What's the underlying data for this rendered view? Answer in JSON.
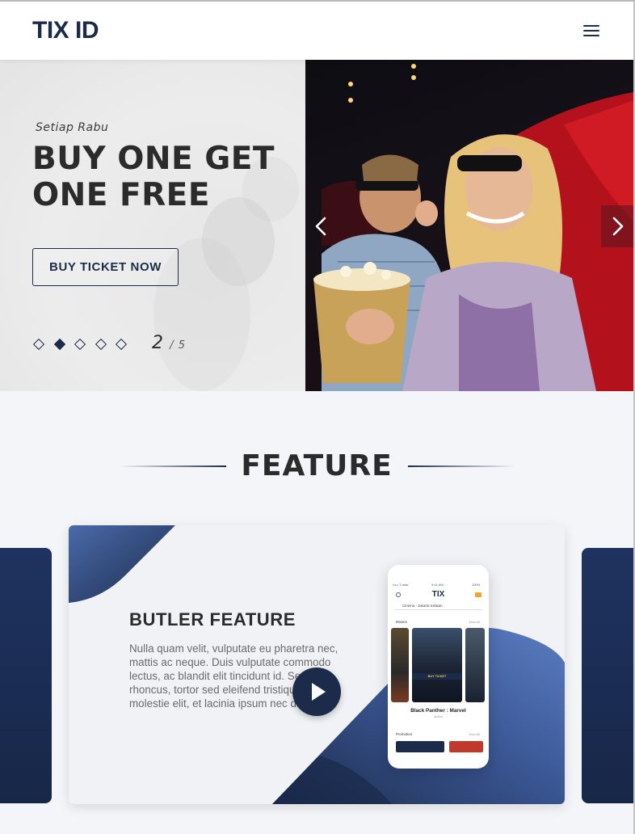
{
  "header": {
    "logo": "TIX ID",
    "menu_icon": "hamburger-menu-icon"
  },
  "hero": {
    "subtitle": "Setiap Rabu",
    "headline": "BUY ONE GET ONE FREE",
    "cta_label": "BUY TICKET NOW",
    "slide_current": "2",
    "slide_separator": "/",
    "slide_total": "5",
    "dots": [
      {
        "active": false
      },
      {
        "active": true
      },
      {
        "active": false
      },
      {
        "active": false
      },
      {
        "active": false
      }
    ],
    "prev_icon": "chevron-left-icon",
    "next_icon": "chevron-right-icon"
  },
  "feature": {
    "heading": "FEATURE",
    "card": {
      "title": "BUTLER FEATURE",
      "text": "Nulla quam velit, vulputate eu pharetra nec, mattis ac neque. Duis vulputate commodo lectus, ac blandit elit tincidunt id. Sed rhoncus, tortor sed eleifend tristique, mauris molestie elit, et lacinia ipsum nec dui.",
      "play_icon": "play-icon"
    },
    "phone": {
      "status_left": "••••• T-mob",
      "status_time": "9:41 AM",
      "status_right": "100%",
      "logo": "TIX",
      "location": "Cinema - Jakarta Selatan",
      "movies_label": "Movies",
      "view_all": "View All",
      "buy_label": "BUY TICKET",
      "movie_title": "Black Panther : Marvel",
      "movie_genre": "Action",
      "promotion_label": "Promotion"
    }
  },
  "colors": {
    "brand_navy": "#1c2b4a",
    "accent_blue": "#4a6aaa",
    "text_dark": "#2b2b2b"
  }
}
